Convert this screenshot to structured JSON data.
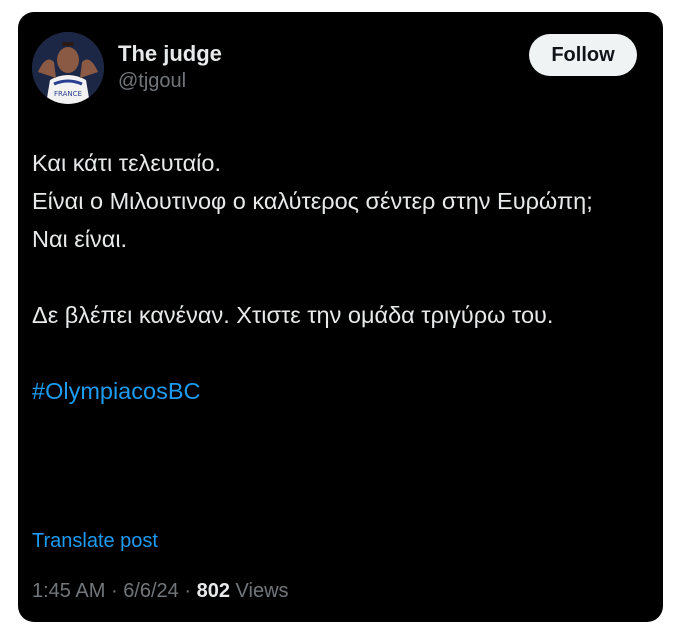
{
  "user": {
    "display_name": "The judge",
    "handle": "@tjgoul",
    "avatar_jersey_text": "FRANCE"
  },
  "follow_button": {
    "label": "Follow"
  },
  "post": {
    "lines": [
      "Και κάτι τελευταίο.",
      "Είναι ο Μιλουτινοφ ο καλύτερος σέντερ στην Ευρώπη;",
      "Ναι είναι.",
      "",
      "Δε βλέπει κανέναν. Χτιστε την ομάδα τριγύρω του.",
      ""
    ],
    "hashtag": "#OlympiacosBC"
  },
  "translate_label": "Translate post",
  "meta": {
    "time": "1:45 AM",
    "separator": "·",
    "date": "6/6/24",
    "views_count": "802",
    "views_label": "Views"
  },
  "colors": {
    "background": "#000000",
    "text": "#e7e9ea",
    "muted": "#71767b",
    "link": "#1d9bf0",
    "button_bg": "#eff3f4"
  }
}
